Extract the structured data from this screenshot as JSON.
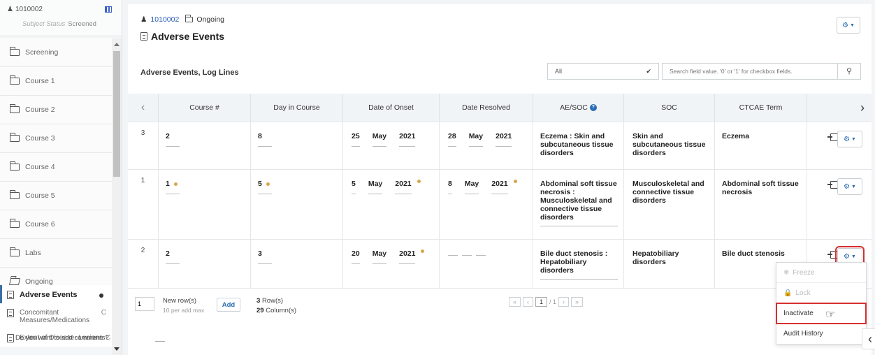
{
  "subject": {
    "id": "1010002",
    "status_label": "Subject Status",
    "status_value": "Screened"
  },
  "sidebar": {
    "items": [
      {
        "label": "Screening"
      },
      {
        "label": "Course 1"
      },
      {
        "label": "Course 2"
      },
      {
        "label": "Course 3"
      },
      {
        "label": "Course 4"
      },
      {
        "label": "Course 5"
      },
      {
        "label": "Course 6"
      },
      {
        "label": "Labs"
      },
      {
        "label": "Ongoing"
      }
    ],
    "forms": [
      {
        "label": "Adverse Events"
      },
      {
        "label": "Concomitant Measures/Medications",
        "suffix": "C"
      },
      {
        "label": "Extent of Disease- Lesions",
        "suffix": "C"
      }
    ]
  },
  "header": {
    "subject_id": "1010002",
    "folder": "Ongoing",
    "title": "Adverse Events"
  },
  "section": {
    "title": "Adverse Events, Log Lines"
  },
  "filter": {
    "selected": "All",
    "search_placeholder": "Search field value. '0' or '1' for checkbox fields."
  },
  "table": {
    "columns": [
      "Course #",
      "Day in Course",
      "Date of Onset",
      "Date Resolved",
      "AE/SOC",
      "SOC",
      "CTCAE Term"
    ],
    "rows": [
      {
        "index": "3",
        "course": "2",
        "day": "8",
        "onset": {
          "d": "25",
          "m": "May",
          "y": "2021"
        },
        "resolved": {
          "d": "28",
          "m": "May",
          "y": "2021"
        },
        "ae_soc": "Eczema : Skin and subcutaneous tissue disorders",
        "soc": "Skin and subcutaneous tissue disorders",
        "ctcae": "Eczema"
      },
      {
        "index": "1",
        "course": "1",
        "day": "5",
        "onset": {
          "d": "5",
          "m": "May",
          "y": "2021"
        },
        "resolved": {
          "d": "8",
          "m": "May",
          "y": "2021"
        },
        "ae_soc": "Abdominal soft tissue necrosis : Musculoskeletal and connective tissue disorders",
        "soc": "Musculoskeletal and connective tissue disorders",
        "ctcae": "Abdominal soft tissue necrosis"
      },
      {
        "index": "2",
        "course": "2",
        "day": "3",
        "onset": {
          "d": "20",
          "m": "May",
          "y": "2021"
        },
        "resolved": {
          "d": "",
          "m": "",
          "y": ""
        },
        "ae_soc": "Bile duct stenosis : Hepatobiliary disorders",
        "soc": "Hepatobiliary disorders",
        "ctcae": "Bile duct stenosis"
      }
    ]
  },
  "footer": {
    "new_rows_value": "1",
    "new_rows_label": "New row(s)",
    "new_rows_hint": "10 per add max",
    "add_label": "Add",
    "rows_count": "3",
    "rows_label": "Row(s)",
    "cols_count": "29",
    "cols_label": "Column(s)",
    "page_current": "1",
    "page_total": "/ 1",
    "comments_prompt": "Do you want to add comments?"
  },
  "menu": {
    "items": [
      {
        "label": "Freeze",
        "disabled": true
      },
      {
        "label": "Lock",
        "disabled": true
      },
      {
        "label": "Inactivate",
        "selected": true
      },
      {
        "label": "Audit History"
      }
    ]
  },
  "icons": {
    "gear": "gear-icon",
    "search": "search-icon",
    "folder": "folder-icon",
    "document": "document-icon",
    "help": "help-icon"
  },
  "colors": {
    "accent": "#2a6db5",
    "highlight": "#d62f2f",
    "marker": "#d9a54a"
  }
}
